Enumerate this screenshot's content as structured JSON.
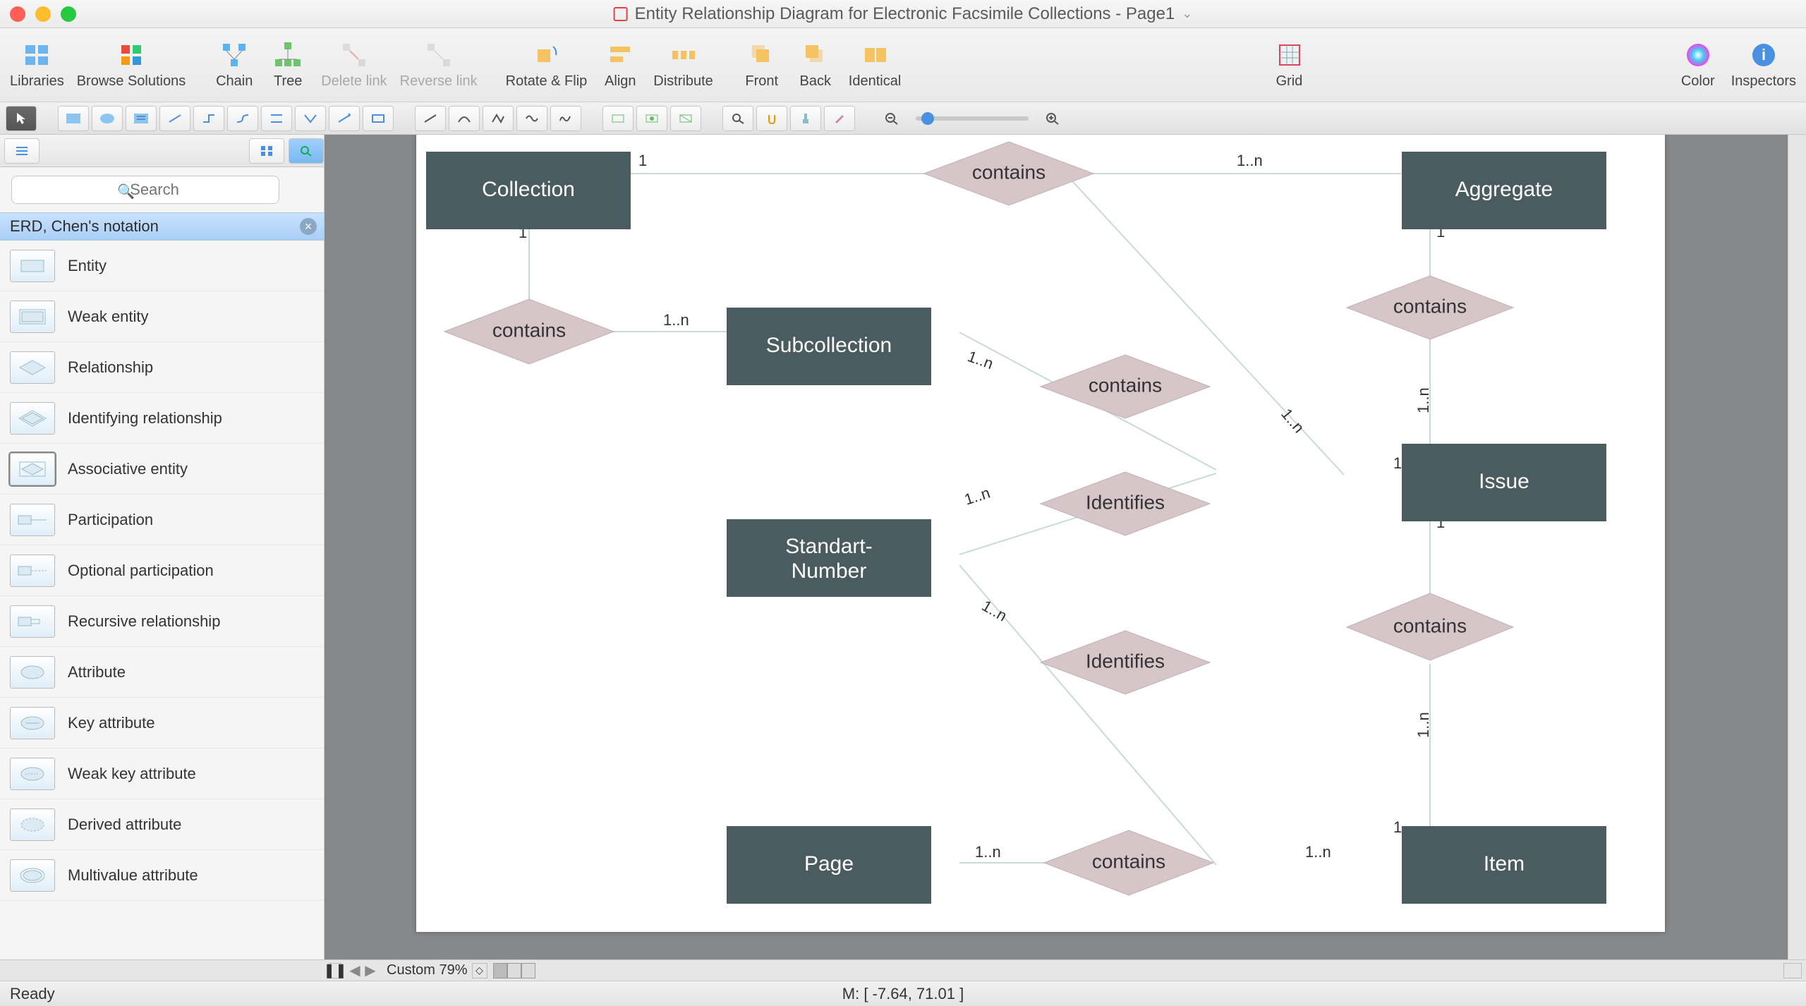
{
  "title": "Entity Relationship Diagram for Electronic Facsimile Collections - Page1",
  "toolbar": {
    "libraries": "Libraries",
    "browse": "Browse Solutions",
    "chain": "Chain",
    "tree": "Tree",
    "deleteLink": "Delete link",
    "reverseLink": "Reverse link",
    "rotate": "Rotate & Flip",
    "align": "Align",
    "distribute": "Distribute",
    "front": "Front",
    "back": "Back",
    "identical": "Identical",
    "grid": "Grid",
    "color": "Color",
    "inspectors": "Inspectors"
  },
  "search": {
    "placeholder": "Search"
  },
  "library": {
    "name": "ERD, Chen's notation",
    "shapes": [
      "Entity",
      "Weak entity",
      "Relationship",
      "Identifying relationship",
      "Associative entity",
      "Participation",
      "Optional participation",
      "Recursive relationship",
      "Attribute",
      "Key attribute",
      "Weak key attribute",
      "Derived attribute",
      "Multivalue attribute"
    ]
  },
  "zoom": {
    "label": "Custom 79%"
  },
  "status": {
    "ready": "Ready",
    "mouse": "M: [ -7.64, 71.01 ]"
  },
  "diagram": {
    "entities": {
      "collection": "Collection",
      "aggregate": "Aggregate",
      "subcollection": "Subcollection",
      "issue": "Issue",
      "standart": "Standart-\nNumber",
      "page": "Page",
      "item": "Item"
    },
    "rels": {
      "contains": "contains",
      "identifies": "Identifies"
    },
    "card": {
      "one": "1",
      "many": "1..n"
    }
  }
}
